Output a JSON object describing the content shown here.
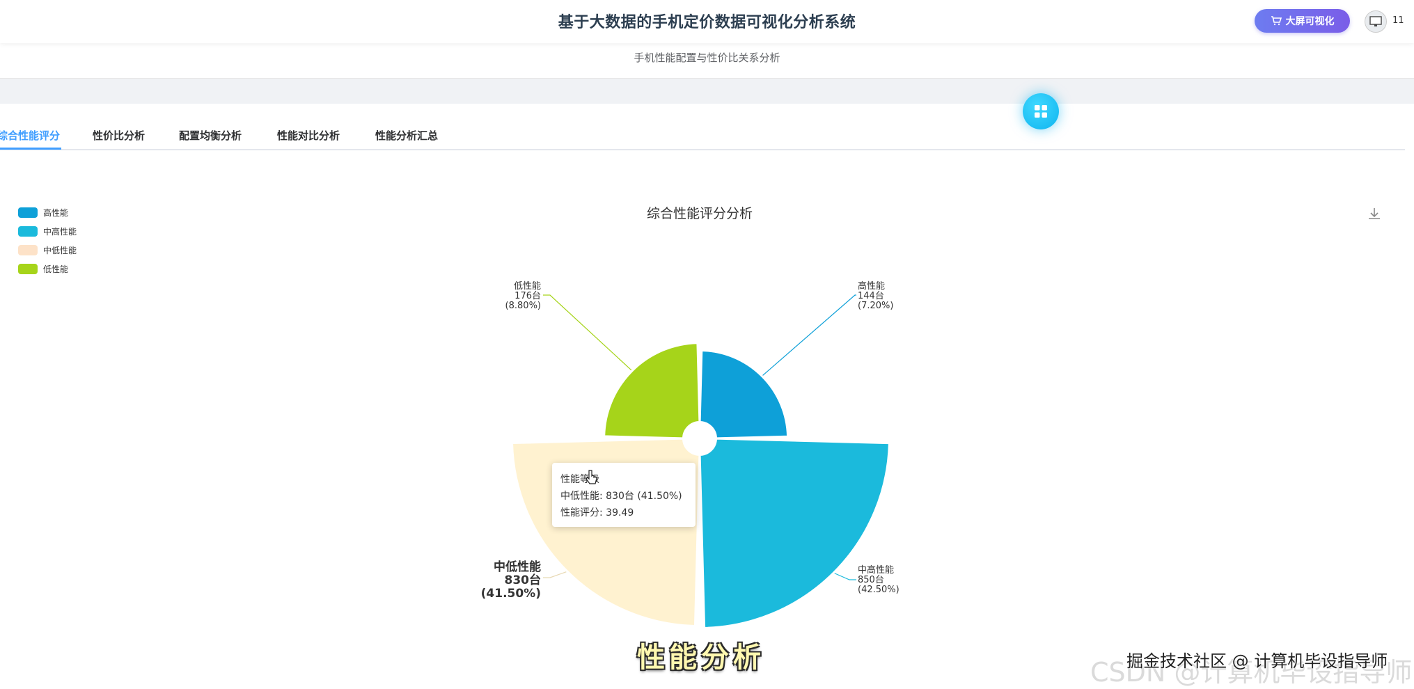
{
  "header": {
    "title": "基于大数据的手机定价数据可视化分析系统",
    "bigscreen_label": "大屏可视化",
    "user_count": "11"
  },
  "page": {
    "subtitle": "手机性能配置与性价比关系分析"
  },
  "tabs": [
    {
      "label": "综合性能评分",
      "active": true
    },
    {
      "label": "性价比分析",
      "active": false
    },
    {
      "label": "配置均衡分析",
      "active": false
    },
    {
      "label": "性能对比分析",
      "active": false
    },
    {
      "label": "性能分析汇总",
      "active": false
    }
  ],
  "chart_data": {
    "type": "pie",
    "subtype": "nightingale-rose",
    "title": "综合性能评分分析",
    "legend_position": "top-left",
    "unit": "台",
    "slices": [
      {
        "name": "高性能",
        "value": 144,
        "percent": "7.20%",
        "color": "#0ea0d8"
      },
      {
        "name": "中高性能",
        "value": 850,
        "percent": "42.50%",
        "color": "#1bbadc"
      },
      {
        "name": "中低性能",
        "value": 830,
        "percent": "41.50%",
        "color": "#fff2d0"
      },
      {
        "name": "低性能",
        "value": 176,
        "percent": "8.80%",
        "color": "#a6d41a"
      }
    ],
    "labels": {
      "high": {
        "name": "高性能",
        "count": "144台",
        "pct": "(7.20%)"
      },
      "midhigh": {
        "name": "中高性能",
        "count": "850台",
        "pct": "(42.50%)"
      },
      "midlow": {
        "name": "中低性能",
        "count": "830台",
        "pct": "(41.50%)"
      },
      "low": {
        "name": "低性能",
        "count": "176台",
        "pct": "(8.80%)"
      }
    },
    "legend_swatch_colors": {
      "high": "#0ea0d8",
      "midhigh": "#1bbadc",
      "midlow": "#fde2c8",
      "low": "#a6d41a"
    }
  },
  "tooltip": {
    "title": "性能等级",
    "line1": "中低性能: 830台 (41.50%)",
    "line2": "性能评分: 39.49"
  },
  "overlay": {
    "caption": "性能分析",
    "watermark_back": "CSDN @计算机毕设指导师",
    "watermark_front": "掘金技术社区 @ 计算机毕设指导师"
  }
}
